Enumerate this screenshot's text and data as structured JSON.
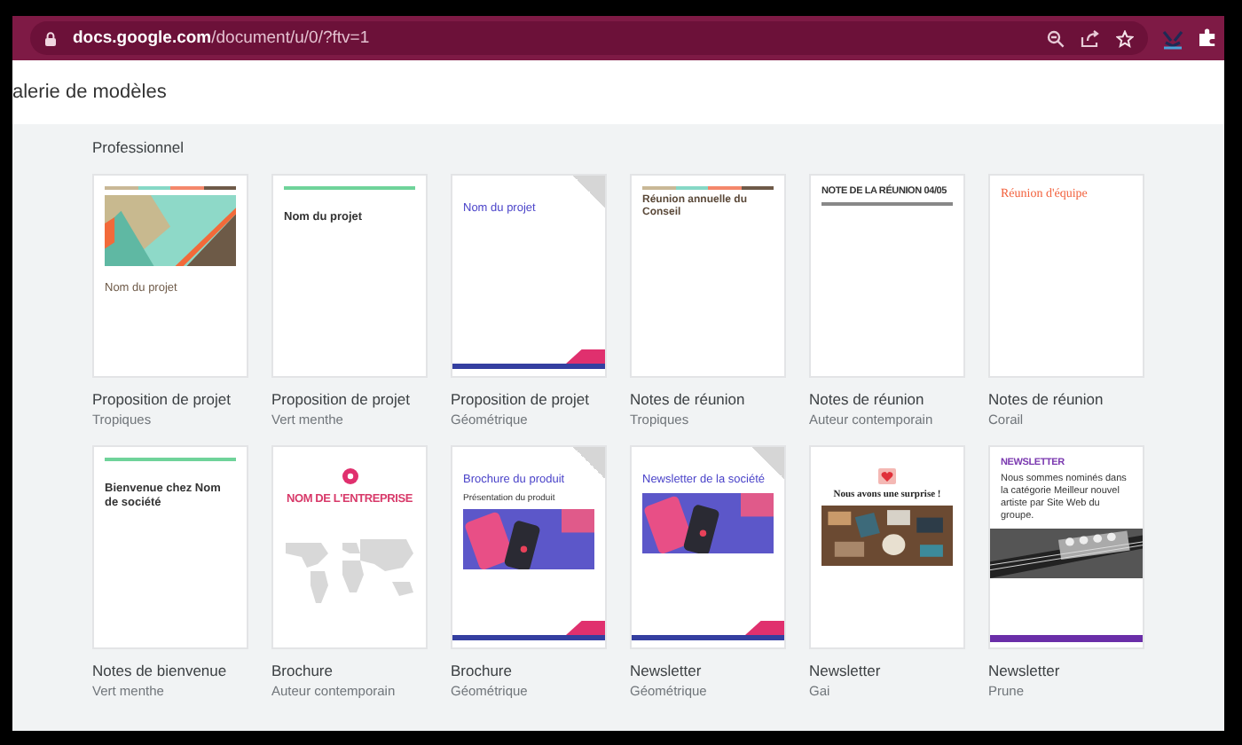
{
  "browser": {
    "url": {
      "host": "docs.google.com",
      "path": "/document/u/0/?ftv=1"
    }
  },
  "header": {
    "title": "alerie de modèles"
  },
  "section": {
    "title": "Professionnel",
    "templates": [
      {
        "name": "Proposition de projet",
        "theme": "Tropiques",
        "thumb": {
          "kind": "banner",
          "heading": "Nom du projet"
        }
      },
      {
        "name": "Proposition de projet",
        "theme": "Vert menthe",
        "thumb": {
          "kind": "mint",
          "heading": "Nom du projet"
        }
      },
      {
        "name": "Proposition de projet",
        "theme": "Géométrique",
        "thumb": {
          "kind": "geometric",
          "heading": "Nom du projet"
        }
      },
      {
        "name": "Notes de réunion",
        "theme": "Tropiques",
        "thumb": {
          "kind": "tropiques-notes",
          "heading": "Réunion annuelle du Conseil"
        }
      },
      {
        "name": "Notes de réunion",
        "theme": "Auteur contemporain",
        "thumb": {
          "kind": "contemporary",
          "heading": "NOTE DE LA RÉUNION 04/05"
        }
      },
      {
        "name": "Notes de réunion",
        "theme": "Corail",
        "thumb": {
          "kind": "coral",
          "heading": "Réunion d'équipe"
        }
      },
      {
        "name": "Notes de bienvenue",
        "theme": "Vert menthe",
        "thumb": {
          "kind": "mint",
          "heading": "Bienvenue chez Nom de société"
        }
      },
      {
        "name": "Brochure",
        "theme": "Auteur contemporain",
        "thumb": {
          "kind": "map",
          "heading": "NOM DE L'ENTREPRISE"
        }
      },
      {
        "name": "Brochure",
        "theme": "Géométrique",
        "thumb": {
          "kind": "geometric-photo",
          "heading": "Brochure du produit",
          "subheading": "Présentation du produit"
        }
      },
      {
        "name": "Newsletter",
        "theme": "Géométrique",
        "thumb": {
          "kind": "geometric-photo",
          "heading": "Newsletter de la société"
        }
      },
      {
        "name": "Newsletter",
        "theme": "Gai",
        "thumb": {
          "kind": "photo-newsletter",
          "heading": "Nous avons une surprise !"
        }
      },
      {
        "name": "Newsletter",
        "theme": "Prune",
        "thumb": {
          "kind": "prune",
          "heading": "NEWSLETTER",
          "subheading": "Nous sommes nominés dans la catégorie Meilleur nouvel artiste par Site Web du groupe."
        }
      }
    ]
  }
}
